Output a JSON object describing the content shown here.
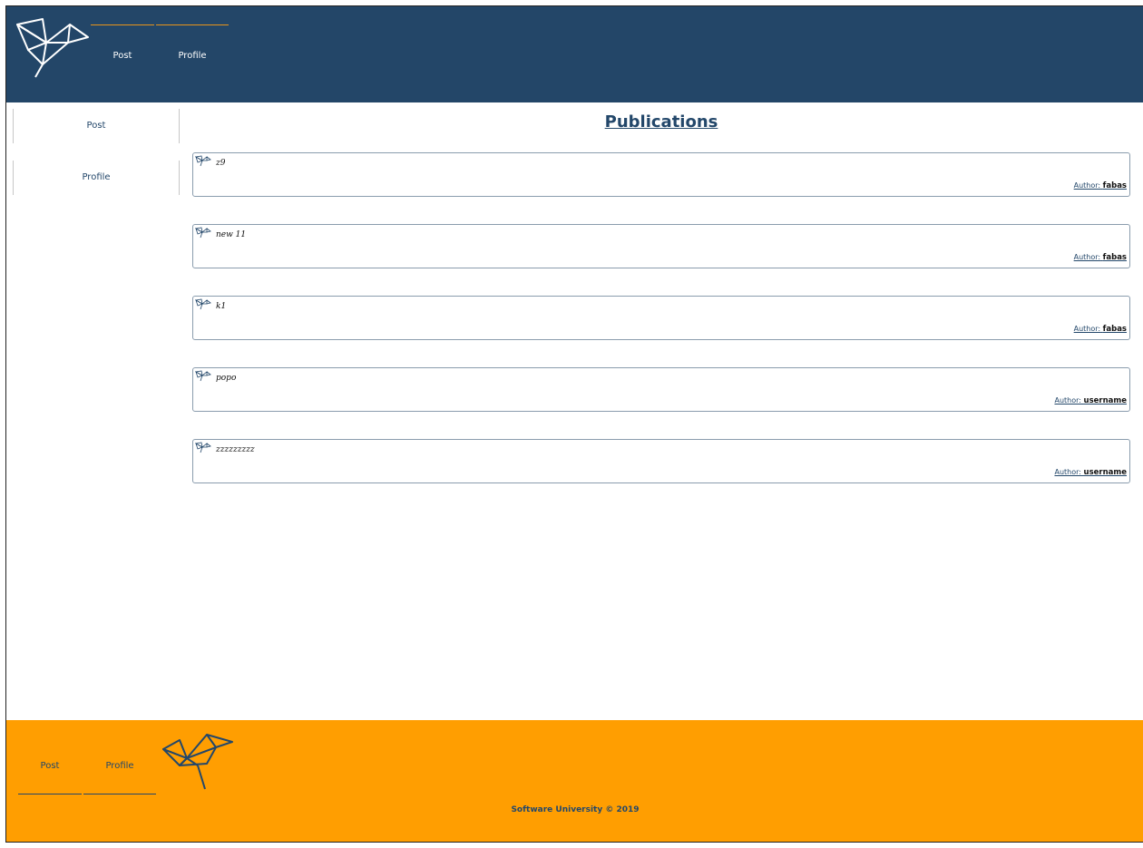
{
  "header": {
    "nav": [
      {
        "label": "Post"
      },
      {
        "label": "Profile"
      }
    ]
  },
  "sidebar": {
    "items": [
      {
        "label": "Post"
      },
      {
        "label": "Profile"
      }
    ]
  },
  "main": {
    "title": "Publications",
    "posts": [
      {
        "title": "z9",
        "author_prefix": "Author:",
        "author": "fabas"
      },
      {
        "title": "new 11",
        "author_prefix": "Author:",
        "author": "fabas"
      },
      {
        "title": "k1",
        "author_prefix": "Author:",
        "author": "fabas"
      },
      {
        "title": "popo",
        "author_prefix": "Author:",
        "author": "username"
      },
      {
        "title": "zzzzzzzzz",
        "author_prefix": "Author:",
        "author": "username"
      }
    ]
  },
  "footer": {
    "nav": [
      {
        "label": "Post"
      },
      {
        "label": "Profile"
      }
    ],
    "copyright": "Software University © 2019"
  },
  "colors": {
    "header_bg": "#234668",
    "footer_bg": "#ff9e01",
    "accent": "#e8951a",
    "text": "#23476a"
  },
  "icons": {
    "logo": "origami-bird-icon",
    "post": "origami-bird-icon"
  }
}
